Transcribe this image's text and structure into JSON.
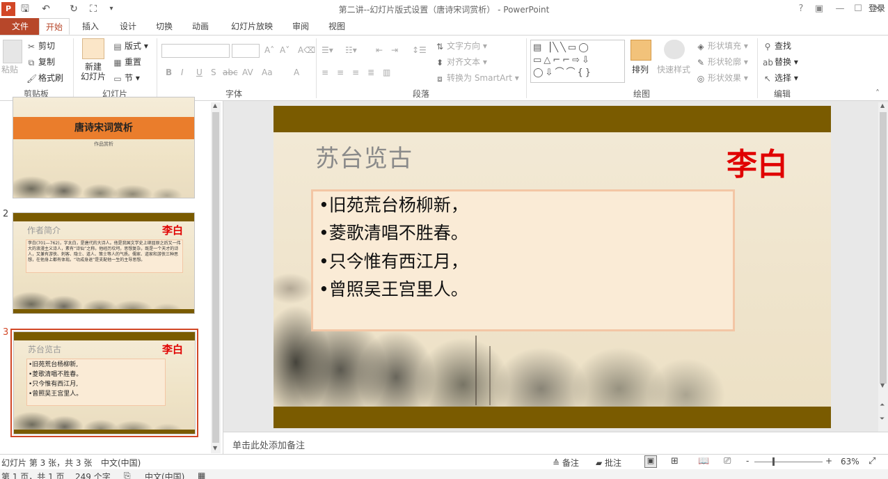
{
  "window": {
    "title": "第二讲--幻灯片版式设置（唐诗宋词赏析） - PowerPoint",
    "signin": "登录",
    "controls": {
      "help": "?",
      "minimize": "—",
      "maximize": "☐",
      "close": "✕"
    }
  },
  "tabs": [
    {
      "label": "文件"
    },
    {
      "label": "开始"
    },
    {
      "label": "插入"
    },
    {
      "label": "设计"
    },
    {
      "label": "切换"
    },
    {
      "label": "动画"
    },
    {
      "label": "幻灯片放映"
    },
    {
      "label": "审阅"
    },
    {
      "label": "视图"
    }
  ],
  "ribbon": {
    "clipboard": {
      "label": "剪贴板",
      "paste": "粘贴",
      "cut": "剪切",
      "copy": "复制",
      "format_painter": "格式刷"
    },
    "slides": {
      "label": "幻灯片",
      "new_slide": "新建\n幻灯片",
      "layout": "版式",
      "reset": "重置",
      "section": "节"
    },
    "font": {
      "label": "字体",
      "bold": "B",
      "italic": "I",
      "underline": "U",
      "shadow": "S",
      "strike": "abc",
      "spacing": "AV",
      "case": "Aa",
      "color": "A"
    },
    "paragraph": {
      "label": "段落",
      "text_direction": "文字方向",
      "align_text": "对齐文本",
      "smartart": "转换为 SmartArt"
    },
    "drawing": {
      "label": "绘图",
      "arrange": "排列",
      "quick_styles": "快速样式",
      "shape_fill": "形状填充",
      "shape_outline": "形状轮廓",
      "shape_effects": "形状效果"
    },
    "editing": {
      "label": "编辑",
      "find": "查找",
      "replace": "替换",
      "select": "选择"
    }
  },
  "thumbnails": [
    {
      "number": "",
      "title": "唐诗宋词赏析",
      "subtitle": "作品赏析"
    },
    {
      "number": "2",
      "title": "作者简介",
      "author": "李白",
      "body": "李白(701—762)，字太白，是唐代的大诗人。他是我国文学史上继屈原之后又一伟大的浪漫主义诗人，素有“诗仙”之称。他经历坎坷，思想复杂，既是一个天才的诗人，又兼有游侠、刺客、隐士、道人、策士等人的气质。儒家、道家和游侠三种思想，在他身上都有体现。“功成身退”是支配他一生的主导思想。"
    },
    {
      "number": "3",
      "title": "苏台览古",
      "author": "李白",
      "lines": [
        "•旧苑荒台杨柳新,",
        "•菱歌清唱不胜春。",
        "•只今惟有西江月,",
        "•曾照吴王宫里人。"
      ]
    }
  ],
  "slide": {
    "title": "苏台览古",
    "author": "李白",
    "lines": [
      "•旧苑荒台杨柳新，",
      "•菱歌清唱不胜春。",
      "•只今惟有西江月，",
      "•曾照吴王宫里人。"
    ]
  },
  "notes_placeholder": "单击此处添加备注",
  "status": {
    "slide_info": "幻灯片 第 3 张，共 3 张",
    "language": "中文(中国)",
    "notes": "备注",
    "comments": "批注",
    "zoom": "63%",
    "zoom_minus": "-",
    "zoom_plus": "+",
    "pages": "第 1 页，共 1 页",
    "chars": "249 个字",
    "lang2": "中文(中国)"
  },
  "colors": {
    "accent": "#b7472a",
    "slide_bar": "#7a5b00",
    "author_red": "#e00000",
    "thumb_title_bar": "#ea7d2c"
  }
}
